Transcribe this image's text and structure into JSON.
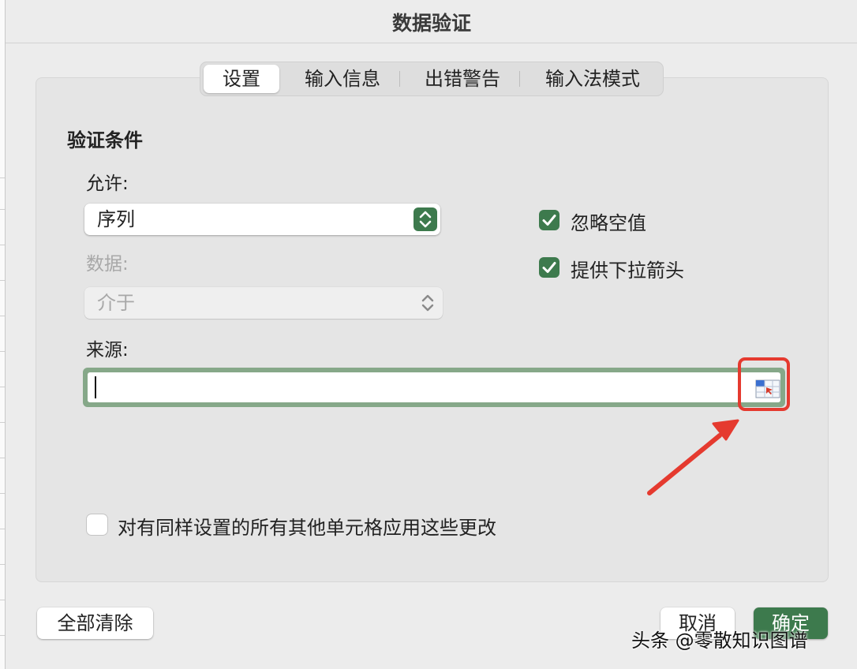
{
  "dialog": {
    "title": "数据验证"
  },
  "tabs": [
    {
      "label": "设置",
      "active": true
    },
    {
      "label": "输入信息",
      "active": false
    },
    {
      "label": "出错警告",
      "active": false
    },
    {
      "label": "输入法模式",
      "active": false
    }
  ],
  "settings": {
    "section_title": "验证条件",
    "allow_label": "允许:",
    "allow_value": "序列",
    "data_label": "数据:",
    "data_value": "介于",
    "source_label": "来源:",
    "source_value": "",
    "ignore_blank": {
      "label": "忽略空值",
      "checked": true
    },
    "dropdown": {
      "label": "提供下拉箭头",
      "checked": true
    },
    "apply_all": {
      "label": "对有同样设置的所有其他单元格应用这些更改",
      "checked": false
    }
  },
  "footer": {
    "clear_all": "全部清除",
    "cancel": "取消",
    "ok": "确定"
  },
  "watermark": "头条 @零散知识图谱",
  "colors": {
    "accent": "#3d7a4d",
    "focus_ring": "#86a889",
    "annotation": "#e53a2f"
  },
  "icons": {
    "stepper": "chevron-up-down-icon",
    "checkbox": "checkmark-icon",
    "range_select": "collapse-dialog-icon"
  }
}
